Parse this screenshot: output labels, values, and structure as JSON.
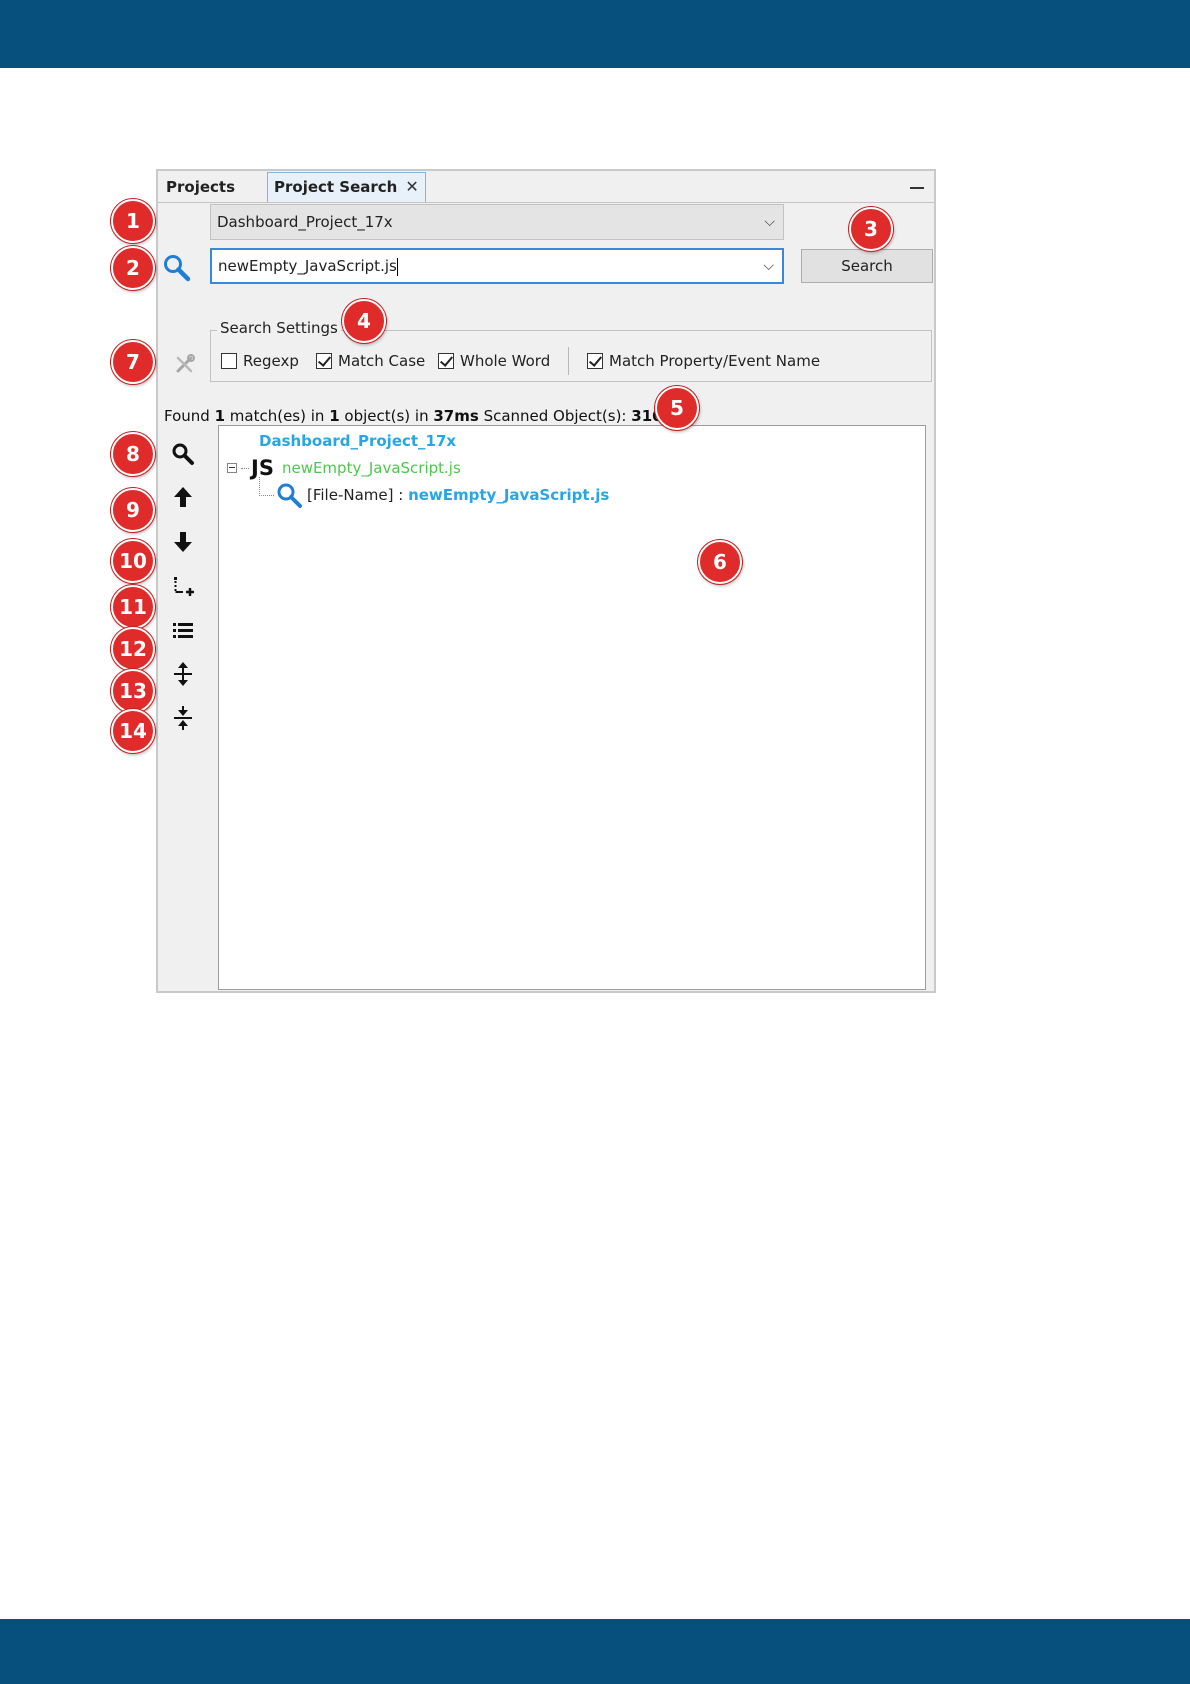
{
  "tabs": [
    {
      "label": "Projects"
    },
    {
      "label": "Project Search"
    }
  ],
  "icons": {
    "tab_close": "close-icon",
    "minimize": "minimize-icon",
    "search": "search-icon",
    "settings": "wrench-icon"
  },
  "project_combo": {
    "value": "Dashboard_Project_17x"
  },
  "search_combo": {
    "value": "newEmpty_JavaScript.js"
  },
  "search_button": {
    "label": "Search"
  },
  "search_settings": {
    "legend": "Search Settings",
    "options": [
      {
        "label": "Regexp",
        "checked": false
      },
      {
        "label": "Match Case",
        "checked": true
      },
      {
        "label": "Whole Word",
        "checked": true
      },
      {
        "label": "Match Property/Event Name",
        "checked": true
      }
    ]
  },
  "status": {
    "p1": "Found ",
    "matches": "1",
    "p2": " match(es) in ",
    "objects": "1",
    "p3": " object(s) in ",
    "time": "37ms",
    "p4": " Scanned Object(s): ",
    "scanned": "310"
  },
  "tree": {
    "project": "Dashboard_Project_17x",
    "file_type": "JS",
    "file": "newEmpty_JavaScript.js",
    "match_label": "[File-Name] : ",
    "match_value": "newEmpty_JavaScript.js"
  },
  "toolbar_tools": [
    {
      "icon": "search-icon"
    },
    {
      "icon": "arrow-up-icon"
    },
    {
      "icon": "arrow-down-icon"
    },
    {
      "icon": "add-child-icon"
    },
    {
      "icon": "list-icon"
    },
    {
      "icon": "expand-all-icon"
    },
    {
      "icon": "collapse-all-icon"
    }
  ],
  "callouts": [
    "1",
    "2",
    "3",
    "4",
    "5",
    "6",
    "7",
    "8",
    "9",
    "10",
    "11",
    "12",
    "13",
    "14"
  ],
  "colors": {
    "band": "#074f7c",
    "badge": "#e02b2b",
    "link": "#27a6e6",
    "js_file": "#4cc94c"
  }
}
